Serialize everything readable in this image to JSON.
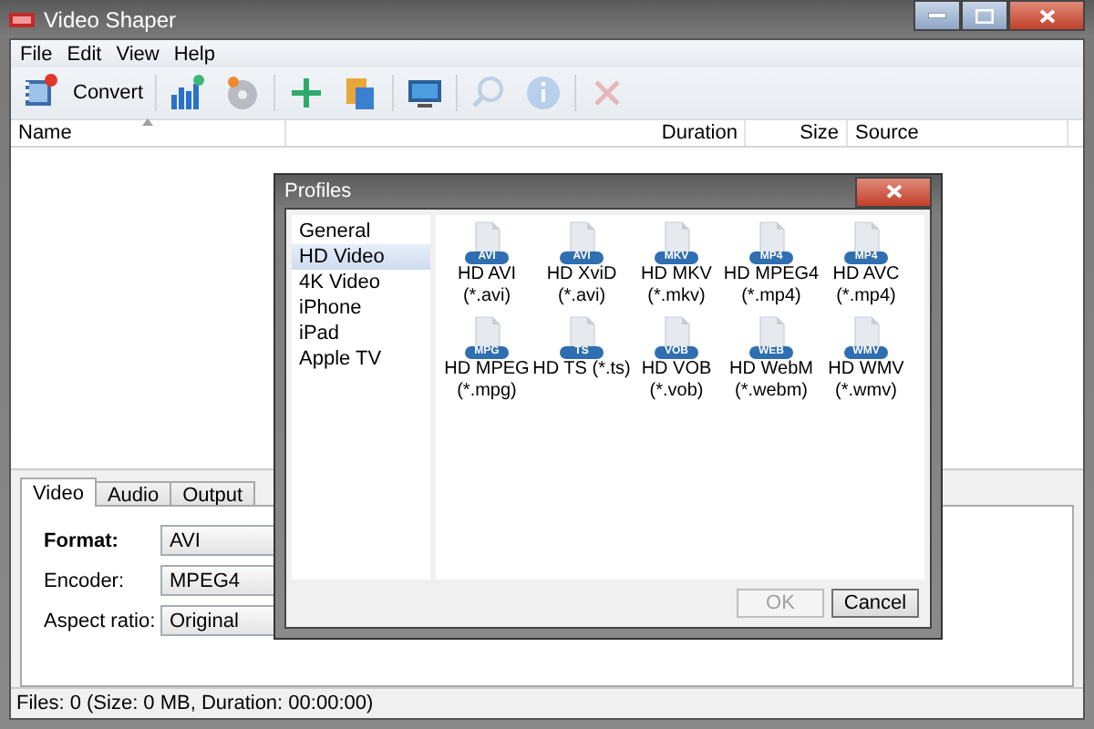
{
  "window": {
    "title": "Video Shaper"
  },
  "menu": [
    "File",
    "Edit",
    "View",
    "Help"
  ],
  "toolbar": [
    {
      "kind": "convert",
      "label": "Convert",
      "disabled": false
    },
    {
      "kind": "sep"
    },
    {
      "kind": "bars",
      "disabled": false
    },
    {
      "kind": "disc",
      "disabled": false
    },
    {
      "kind": "sep"
    },
    {
      "kind": "add",
      "disabled": false
    },
    {
      "kind": "paste",
      "disabled": false
    },
    {
      "kind": "sep"
    },
    {
      "kind": "monitor",
      "disabled": false
    },
    {
      "kind": "sep"
    },
    {
      "kind": "search",
      "disabled": true
    },
    {
      "kind": "info",
      "disabled": true
    },
    {
      "kind": "sep"
    },
    {
      "kind": "delete",
      "disabled": true
    }
  ],
  "table": {
    "columns": [
      {
        "label": "Name",
        "sorted": true
      },
      {
        "label": "Duration",
        "sorted": false
      },
      {
        "label": "Size",
        "sorted": false
      },
      {
        "label": "Source",
        "sorted": false
      }
    ]
  },
  "tabs": [
    {
      "label": "Video",
      "selected": true
    },
    {
      "label": "Audio",
      "selected": false
    },
    {
      "label": "Output",
      "selected": false
    }
  ],
  "settings": [
    {
      "label": "Format:",
      "value": "AVI",
      "bold": true
    },
    {
      "label": "Encoder:",
      "value": "MPEG4",
      "bold": false
    },
    {
      "label": "Aspect ratio:",
      "value": "Original",
      "bold": false
    }
  ],
  "status_bar": "Files: 0 (Size: 0 MB, Duration: 00:00:00)",
  "dialog": {
    "title": "Profiles",
    "categories": [
      {
        "label": "General",
        "selected": false
      },
      {
        "label": "HD Video",
        "selected": true
      },
      {
        "label": "4K Video",
        "selected": false
      },
      {
        "label": "iPhone",
        "selected": false
      },
      {
        "label": "iPad",
        "selected": false
      },
      {
        "label": "Apple TV",
        "selected": false
      }
    ],
    "profiles": [
      {
        "tag": "AVI",
        "lines": [
          "HD AVI",
          "(*.avi)"
        ]
      },
      {
        "tag": "AVI",
        "lines": [
          "HD XviD",
          "(*.avi)"
        ]
      },
      {
        "tag": "MKV",
        "lines": [
          "HD MKV",
          "(*.mkv)"
        ]
      },
      {
        "tag": "MP4",
        "lines": [
          "HD MPEG4",
          "(*.mp4)"
        ]
      },
      {
        "tag": "MP4",
        "lines": [
          "HD AVC",
          "(*.mp4)"
        ]
      },
      {
        "tag": "MPG",
        "lines": [
          "HD MPEG",
          "(*.mpg)"
        ]
      },
      {
        "tag": "TS",
        "lines": [
          "HD TS (*.ts)"
        ]
      },
      {
        "tag": "VOB",
        "lines": [
          "HD VOB",
          "(*.vob)"
        ]
      },
      {
        "tag": "WEB",
        "lines": [
          "HD WebM",
          "(*.webm)"
        ]
      },
      {
        "tag": "WMV",
        "lines": [
          "HD WMV",
          "(*.wmv)"
        ]
      }
    ],
    "buttons": [
      {
        "label": "OK",
        "disabled": true
      },
      {
        "label": "Cancel",
        "disabled": false
      }
    ]
  }
}
